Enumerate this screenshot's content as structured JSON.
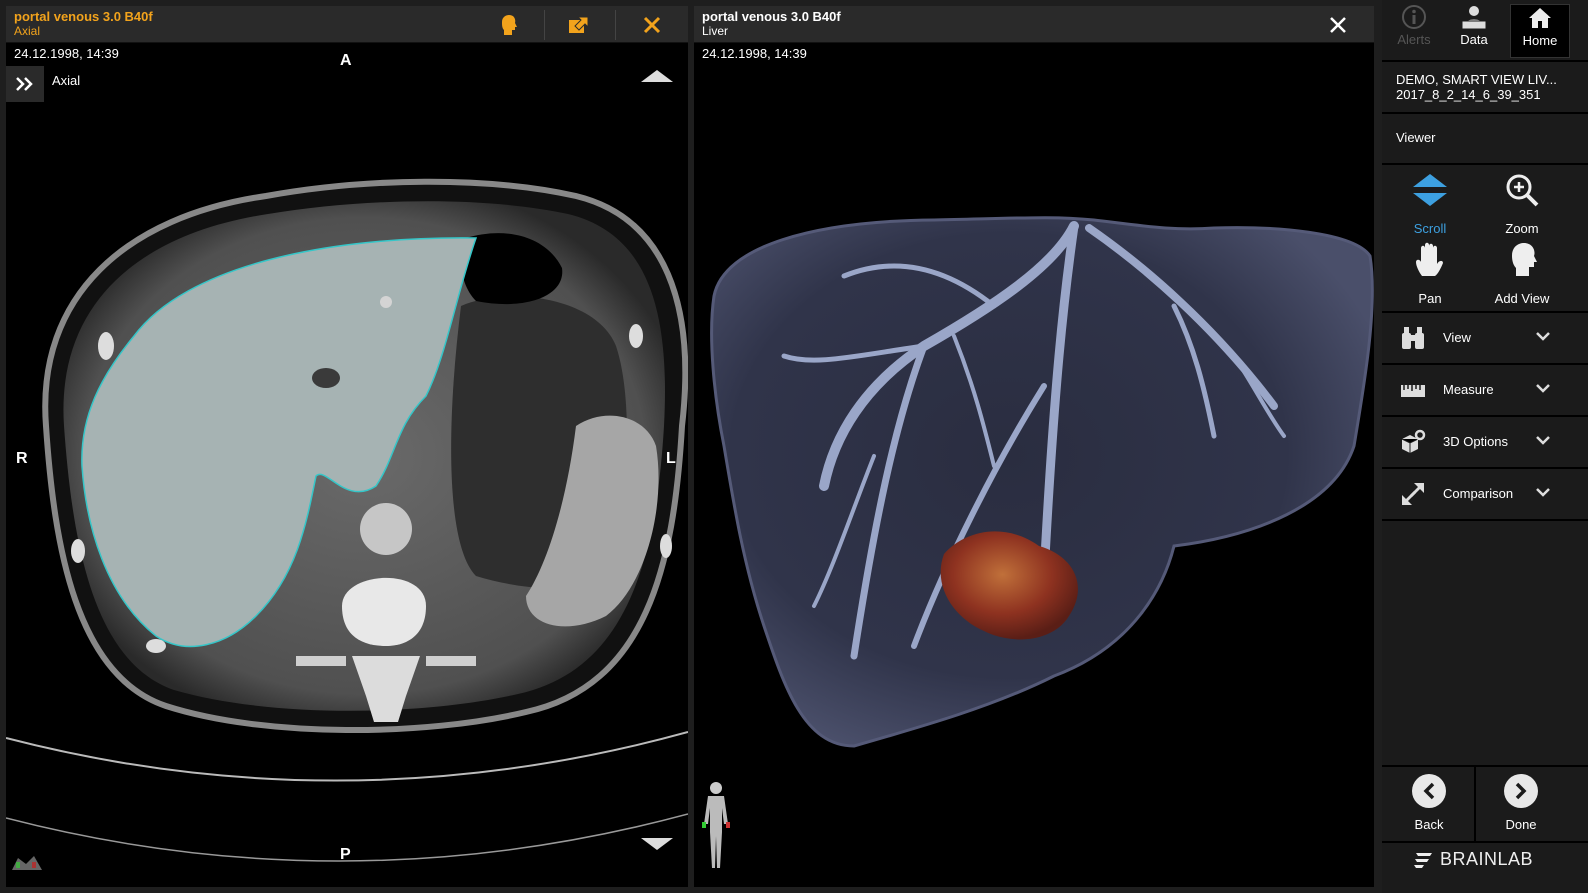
{
  "left_panel": {
    "title": "portal venous 3.0 B40f",
    "subtitle": "Axial",
    "datetime": "24.12.1998, 14:39",
    "view_label": "Axial",
    "orientation": {
      "top": "A",
      "bottom": "P",
      "left": "R",
      "right": "L"
    }
  },
  "right_panel": {
    "title": "portal venous 3.0 B40f",
    "subtitle": "Liver",
    "datetime": "24.12.1998, 14:39"
  },
  "sidebar": {
    "top_buttons": [
      {
        "label": "Alerts",
        "icon": "info-icon",
        "enabled": false
      },
      {
        "label": "Data",
        "icon": "patient-data-icon",
        "enabled": true
      },
      {
        "label": "Home",
        "icon": "home-icon",
        "enabled": true,
        "selected": true
      }
    ],
    "patient_name": "DEMO, SMART VIEW LIV...",
    "patient_id": "2017_8_2_14_6_39_351",
    "viewer_heading": "Viewer",
    "tools": [
      {
        "label": "Scroll",
        "icon": "scroll-icon",
        "active": true
      },
      {
        "label": "Zoom",
        "icon": "zoom-icon",
        "active": false
      },
      {
        "label": "Pan",
        "icon": "hand-icon",
        "active": false
      },
      {
        "label": "Add View",
        "icon": "head-icon",
        "active": false
      }
    ],
    "menus": [
      {
        "label": "View",
        "icon": "binoculars-icon"
      },
      {
        "label": "Measure",
        "icon": "ruler-icon"
      },
      {
        "label": "3D Options",
        "icon": "cube-gear-icon"
      },
      {
        "label": "Comparison",
        "icon": "compare-arrows-icon"
      }
    ],
    "nav": {
      "back": "Back",
      "done": "Done"
    },
    "brand": "BRAINLAB"
  },
  "colors": {
    "left_title": "#f2a31c",
    "accent_blue": "#3da0e0",
    "contour": "#35c6c8",
    "tumor": "#8e3220"
  }
}
